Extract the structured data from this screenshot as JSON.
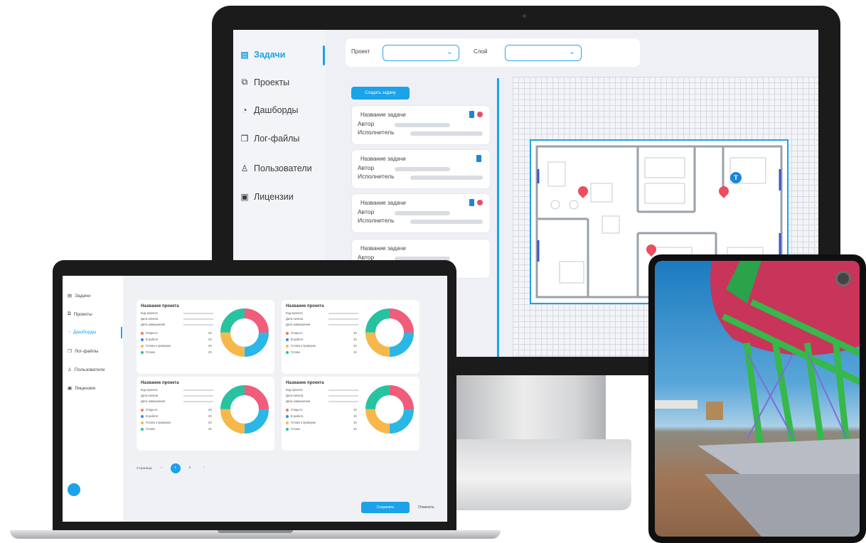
{
  "monitor": {
    "sidebar": {
      "items": [
        {
          "label": "Задачи",
          "icon": "tasks-icon"
        },
        {
          "label": "Проекты",
          "icon": "projects-icon"
        },
        {
          "label": "Дашборды",
          "icon": "dashboard-icon"
        },
        {
          "label": "Лог-файлы",
          "icon": "log-files-icon"
        },
        {
          "label": "Пользователи",
          "icon": "users-icon"
        },
        {
          "label": "Лицензии",
          "icon": "license-icon"
        }
      ]
    },
    "filters": {
      "project_label": "Проект",
      "layer_label": "Слой"
    },
    "create_task_label": "Создать задачу",
    "tasks": [
      {
        "name": "Название задачи",
        "author_label": "Автор",
        "assignee_label": "Исполнитель"
      },
      {
        "name": "Название задачи",
        "author_label": "Автор",
        "assignee_label": "Исполнитель"
      },
      {
        "name": "Название задачи",
        "author_label": "Автор",
        "assignee_label": "Исполнитель"
      },
      {
        "name": "Название задачи",
        "author_label": "Автор",
        "assignee_label": ""
      }
    ],
    "plan_badge": "T"
  },
  "laptop": {
    "sidebar": {
      "items": [
        {
          "label": "Задачи",
          "icon": "tasks-icon"
        },
        {
          "label": "Проекты",
          "icon": "projects-icon"
        },
        {
          "label": "Дашборды",
          "icon": "dashboard-icon"
        },
        {
          "label": "Лог-файлы",
          "icon": "log-files-icon"
        },
        {
          "label": "Пользователи",
          "icon": "users-icon"
        },
        {
          "label": "Лицензии",
          "icon": "license-icon"
        }
      ]
    },
    "cards": [
      {
        "title": "Название проекта",
        "fields": [
          "Код проекта",
          "Дата начала",
          "Дата завершения"
        ],
        "statuses": [
          {
            "label": "Открыто",
            "value": "20"
          },
          {
            "label": "В работе",
            "value": "20"
          },
          {
            "label": "Готово к проверке",
            "value": "20"
          },
          {
            "label": "Готово",
            "value": "20"
          }
        ]
      },
      {
        "title": "Название проекта",
        "fields": [
          "Код проекта",
          "Дата начала",
          "Дата завершения"
        ],
        "statuses": [
          {
            "label": "Открыто",
            "value": "10"
          },
          {
            "label": "В работе",
            "value": "10"
          },
          {
            "label": "Готово к проверке",
            "value": "10"
          },
          {
            "label": "Готово",
            "value": "10"
          }
        ]
      },
      {
        "title": "Название проекта",
        "fields": [
          "Код проекта",
          "Дата начала",
          "Дата завершения"
        ],
        "statuses": [
          {
            "label": "Открыто",
            "value": "20"
          },
          {
            "label": "В работе",
            "value": "20"
          },
          {
            "label": "Готово к проверке",
            "value": "20"
          },
          {
            "label": "Готово",
            "value": "20"
          }
        ]
      },
      {
        "title": "Название проекта",
        "fields": [
          "Код проекта",
          "Дата начала",
          "Дата завершения"
        ],
        "statuses": [
          {
            "label": "Открыто",
            "value": "10"
          },
          {
            "label": "В работе",
            "value": "10"
          },
          {
            "label": "Готово к проверке",
            "value": "10"
          },
          {
            "label": "Готово",
            "value": "10"
          }
        ]
      }
    ],
    "donut_colors": [
      "#ef5d7a",
      "#2ab7e6",
      "#f7b84b",
      "#27c3a0"
    ],
    "pager": {
      "label": "Страница",
      "prev": "‹",
      "current": "1",
      "next_page": "2",
      "next": "›"
    },
    "primary_button": "Сохранить",
    "secondary_button": "Отменить"
  }
}
